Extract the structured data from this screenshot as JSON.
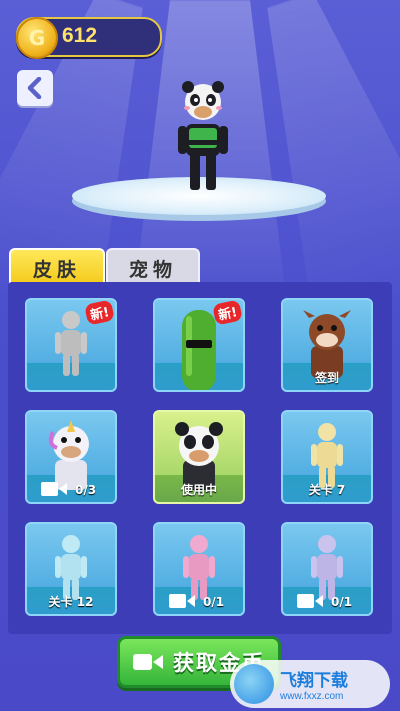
{
  "coins": {
    "count": "612",
    "icon": "coin-icon",
    "symbol": "G"
  },
  "back_icon": "chevron-left-icon",
  "tabs": [
    {
      "label": "皮肤",
      "active": true
    },
    {
      "label": "宠物",
      "active": false
    }
  ],
  "skins": [
    {
      "badge": "新!",
      "label": "",
      "status": "locked-silhouette"
    },
    {
      "badge": "新!",
      "label": "",
      "status": "cucumber-skin"
    },
    {
      "badge": "",
      "label": "签到",
      "status": "cow-skin"
    },
    {
      "badge": "",
      "label": "",
      "video_count": "0/3",
      "status": "unicorn-skin"
    },
    {
      "badge": "",
      "label": "使用中",
      "status": "panda-skin-in-use"
    },
    {
      "badge": "",
      "label": "关卡 7",
      "status": "locked-silhouette"
    },
    {
      "badge": "",
      "label": "",
      "status": "locked-silhouette"
    },
    {
      "badge": "",
      "label": "",
      "video_count": "0/1",
      "status": "locked-silhouette"
    },
    {
      "badge": "",
      "label": "",
      "video_count": "0/1",
      "status": "locked-silhouette"
    }
  ],
  "skin_extra_labels": {
    "row3_col1": "关卡 12"
  },
  "get_coins_button": {
    "label": "获取金币",
    "icon": "video-icon"
  },
  "watermark": {
    "title": "飞翔下载",
    "url": "www.fxxz.com"
  },
  "colors": {
    "accent_yellow": "#f3c918",
    "button_green": "#34b53a",
    "background": "#4b4fcd"
  }
}
